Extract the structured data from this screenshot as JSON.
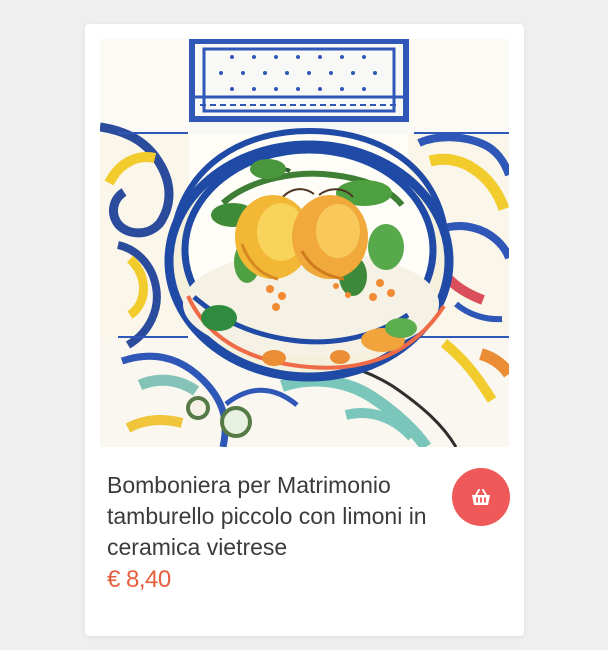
{
  "product": {
    "title": "Bomboniera per Matrimonio tamburello piccolo con limoni in ceramica vietrese",
    "price": "€ 8,40",
    "image_icon": "ceramic-lemon-dish-photo"
  },
  "actions": {
    "cart_icon": "shopping-basket-icon"
  },
  "colors": {
    "accent_price": "#e65f3d",
    "cart_button": "#ef5959",
    "card_background": "#ffffff",
    "page_background": "#efefef"
  }
}
